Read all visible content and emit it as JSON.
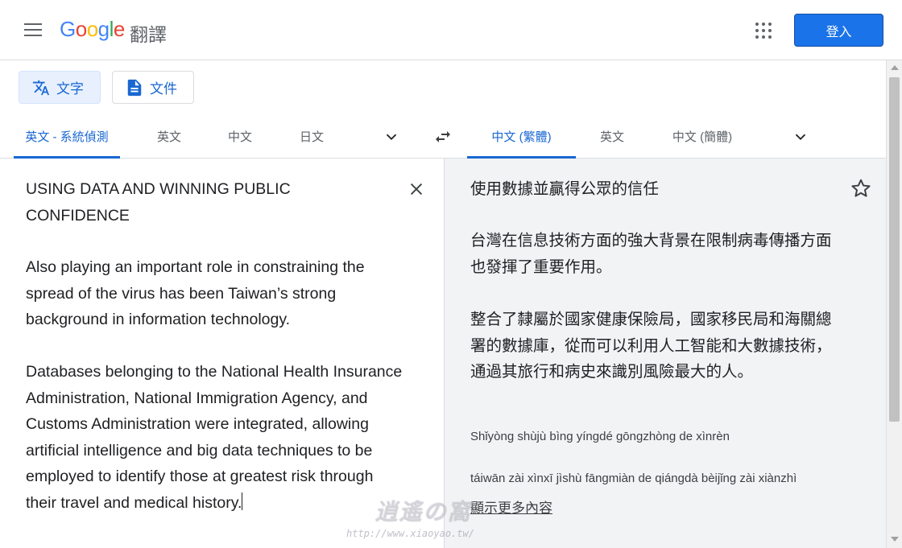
{
  "header": {
    "logo": {
      "g1": "G",
      "o1": "o",
      "o2": "o",
      "g2": "g",
      "l": "l",
      "e": "e"
    },
    "product_name": "翻譯",
    "signin_label": "登入",
    "brand_color": "#1a73e8"
  },
  "modes": {
    "text_label": "文字",
    "document_label": "文件"
  },
  "source_languages": [
    "英文 - 系統偵測",
    "英文",
    "中文",
    "日文"
  ],
  "target_languages": [
    "中文 (繁體)",
    "英文",
    "中文 (簡體)"
  ],
  "source": {
    "title": "USING DATA AND WINNING PUBLIC CONFIDENCE",
    "p1": "Also playing an important role in constraining the spread of the virus has been Taiwan’s strong background in information technology.",
    "p2": "Databases belonging to the National Health Insurance Administration, National Immigration Agency, and Customs Administration were integrated, allowing artificial intelligence and big data techniques to be employed to identify those at greatest risk through their travel and medical history."
  },
  "target": {
    "title": "使用數據並贏得公眾的信任",
    "p1": "台灣在信息技術方面的強大背景在限制病毒傳播方面也發揮了重要作用。",
    "p2": "整合了隸屬於國家健康保險局，國家移民局和海關總署的數據庫，從而可以利用人工智能和大數據技術，通過其旅行和病史來識別風險最大的人。",
    "pinyin1": "Shǐyòng shùjù bìng yíngdé gōngzhòng de xìnrèn",
    "pinyin2": "táiwān zài xìnxī jìshù fāngmiàn de qiángdà bèijǐng zài xiànzhì",
    "show_more": "顯示更多內容"
  },
  "watermark": {
    "main": "逍遙の窩",
    "url": "http://www.xiaoyao.tw/"
  },
  "icons": [
    "menu-icon",
    "apps-icon",
    "translate-icon",
    "document-icon",
    "chevron-down-icon",
    "swap-icon",
    "close-icon",
    "star-icon"
  ]
}
